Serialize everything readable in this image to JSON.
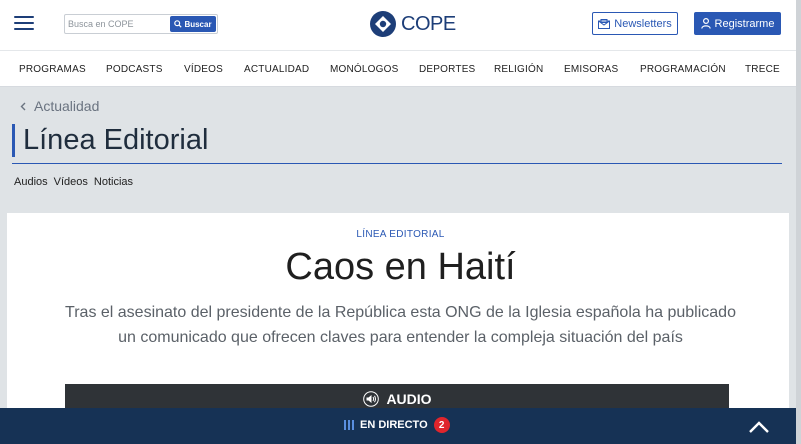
{
  "header": {
    "search_placeholder": "Busca en COPE",
    "search_button": "Buscar",
    "logo_text": "COPE",
    "newsletters_label": "Newsletters",
    "register_label": "Registrarme"
  },
  "nav": {
    "items": [
      "PROGRAMAS",
      "PODCASTS",
      "VÍDEOS",
      "ACTUALIDAD",
      "MONÓLOGOS",
      "DEPORTES",
      "RELIGIÓN",
      "EMISORAS",
      "PROGRAMACIÓN",
      "TRECE"
    ]
  },
  "section": {
    "breadcrumb": "Actualidad",
    "title": "Línea Editorial",
    "subnav": [
      "Audios",
      "Vídeos",
      "Noticias"
    ]
  },
  "article": {
    "kicker": "LÍNEA EDITORIAL",
    "headline": "Caos en Haití",
    "lede": "Tras el asesinato del presidente de la República esta ONG de la Iglesia española ha publicado un comunicado que ofrecen claves para entender la compleja situación del país",
    "audio_label": "AUDIO"
  },
  "live": {
    "label": "EN DIRECTO",
    "count": "2"
  },
  "colors": {
    "brand_blue": "#2a58b4",
    "navy": "#163255",
    "live_badge": "#e0252c"
  },
  "icons": [
    "menu-icon",
    "search-icon",
    "cope-logo-icon",
    "newsletter-icon",
    "user-icon",
    "chevron-left-icon",
    "speaker-icon",
    "live-bars-icon",
    "chevron-up-icon"
  ]
}
